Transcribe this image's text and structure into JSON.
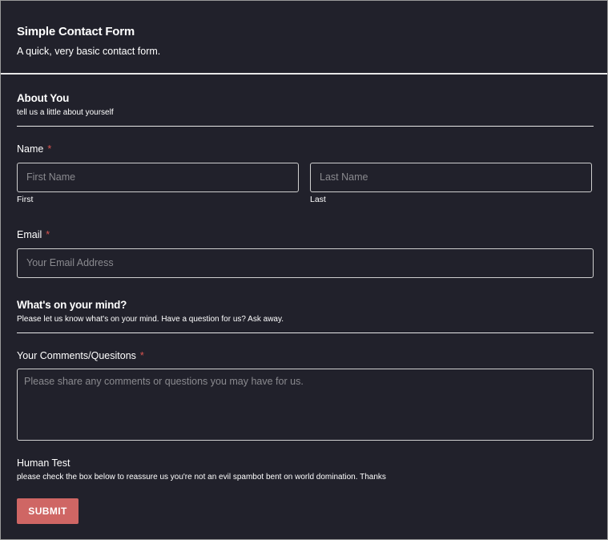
{
  "form": {
    "title": "Simple Contact Form",
    "description": "A quick, very basic contact form."
  },
  "about_section": {
    "title": "About You",
    "subtitle": "tell us a little about yourself"
  },
  "name_field": {
    "label": "Name",
    "required_mark": "*",
    "first_placeholder": "First Name",
    "first_sublabel": "First",
    "last_placeholder": "Last Name",
    "last_sublabel": "Last"
  },
  "email_field": {
    "label": "Email",
    "required_mark": "*",
    "placeholder": "Your Email Address"
  },
  "mind_section": {
    "title": "What's on your mind?",
    "subtitle": "Please let us know what's on your mind. Have a question for us? Ask away."
  },
  "comments_field": {
    "label": "Your Comments/Quesitons",
    "required_mark": "*",
    "placeholder": "Please share any comments or questions you may have for us."
  },
  "human_test": {
    "label": "Human Test",
    "description": "please check the box below to reassure us you're not an evil spambot bent on world domination. Thanks"
  },
  "submit": {
    "label": "SUBMIT"
  },
  "colors": {
    "background": "#21212b",
    "text": "#ffffff",
    "required": "#d9534f",
    "submit_button": "#cf6664",
    "placeholder": "#8a8a8f"
  }
}
